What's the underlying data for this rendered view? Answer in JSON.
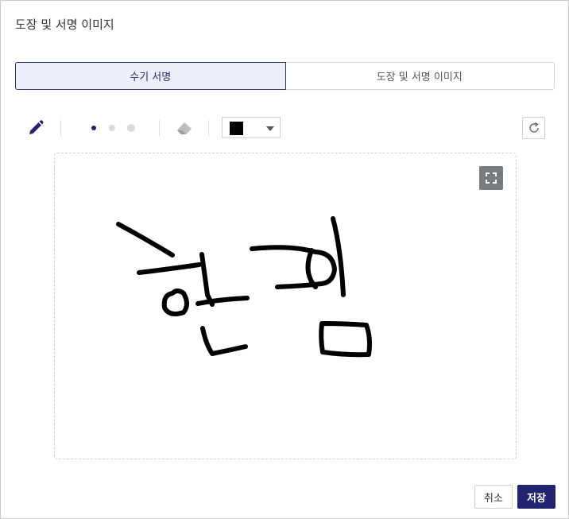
{
  "dialog": {
    "title": "도장 및 서명 이미지"
  },
  "tabs": [
    {
      "label": "수기 서명",
      "active": true
    },
    {
      "label": "도장 및 서명 이미지",
      "active": false
    }
  ],
  "toolbar": {
    "pen_icon": "pencil-icon",
    "brush_sizes": [
      "small",
      "medium",
      "large"
    ],
    "selected_brush_size": "small",
    "eraser_icon": "eraser-icon",
    "selected_color": "#000000",
    "refresh_icon": "refresh-icon"
  },
  "canvas": {
    "fullscreen_icon": "expand-icon"
  },
  "actions": {
    "cancel_label": "취소",
    "save_label": "저장"
  },
  "colors": {
    "accent": "#1f2370",
    "tab_active_bg": "#eceef8",
    "pen_color": "#1f2370"
  }
}
